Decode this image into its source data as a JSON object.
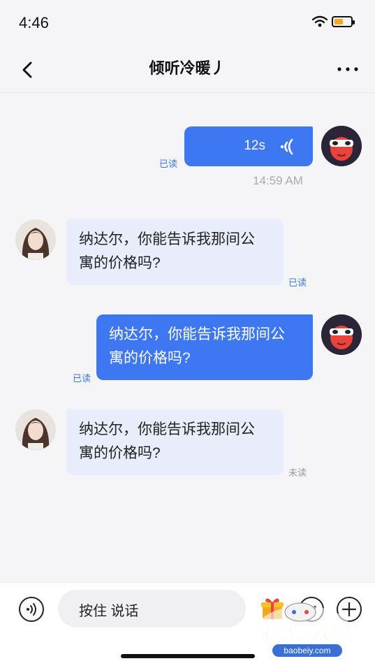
{
  "status": {
    "time": "4:46"
  },
  "header": {
    "title": "倾听冷暖丿"
  },
  "messages": [
    {
      "type": "voice",
      "direction": "out",
      "duration": "12s",
      "read_status": "已读",
      "timestamp": "14:59 AM"
    },
    {
      "type": "text",
      "direction": "in",
      "line1": "纳达尔，你能告诉我那间公",
      "line2": "寓的价格吗?",
      "read_status": "已读"
    },
    {
      "type": "text",
      "direction": "out",
      "line1": "纳达尔，你能告诉我那间公",
      "line2": "寓的价格吗?",
      "read_status": "已读"
    },
    {
      "type": "text",
      "direction": "in",
      "line1": "纳达尔，你能告诉我那间公",
      "line2": "寓的价格吗?",
      "read_status": "未读"
    }
  ],
  "input": {
    "hold_to_talk": "按住 说话"
  },
  "watermark": {
    "main": "宝贝游戏网",
    "sub": "baobeiy.com"
  },
  "colors": {
    "accent": "#3d78f2",
    "incoming_bubble": "#e9edfb",
    "background": "#f5f5f7"
  },
  "icons": [
    "back-icon",
    "more-icon",
    "voice-wave-icon",
    "voice-toggle-icon",
    "gift-icon",
    "emoji-icon",
    "plus-icon"
  ]
}
